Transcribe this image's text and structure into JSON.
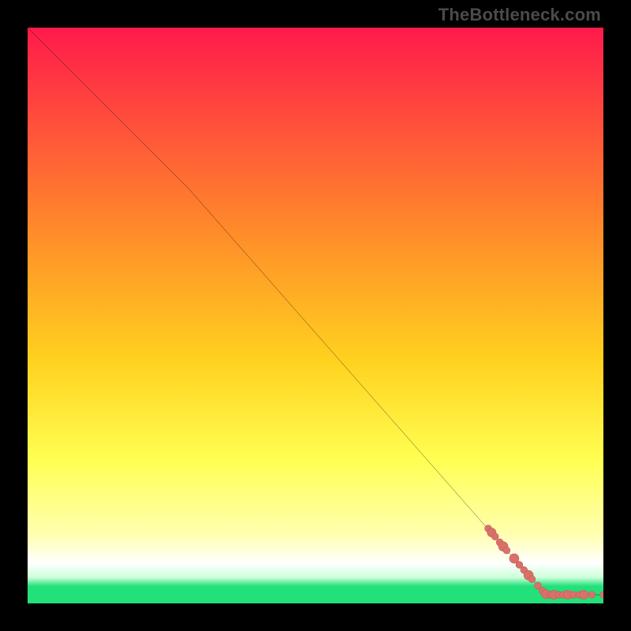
{
  "watermark": "TheBottleneck.com",
  "colors": {
    "gradient_top": "#ff1a4b",
    "gradient_mid1": "#ff8a2a",
    "gradient_mid2": "#ffd21f",
    "gradient_mid3": "#ffff52",
    "gradient_pale": "#ffffb0",
    "gradient_white": "#ffffff",
    "gradient_mint": "#ccffd9",
    "gradient_green": "#22e07a",
    "line": "#000000",
    "marker_fill": "#d9716b",
    "marker_stroke": "#c85a53",
    "frame": "#000000"
  },
  "chart_data": {
    "type": "line",
    "title": "",
    "xlabel": "",
    "ylabel": "",
    "xlim": [
      0,
      100
    ],
    "ylim": [
      0,
      100
    ],
    "series": [
      {
        "name": "curve",
        "kind": "line",
        "points": [
          {
            "x": 0,
            "y": 100
          },
          {
            "x": 28,
            "y": 72
          },
          {
            "x": 90,
            "y": 1.5
          },
          {
            "x": 100,
            "y": 1.5
          }
        ]
      },
      {
        "name": "markers",
        "kind": "scatter",
        "points": [
          {
            "x": 80.0,
            "y": 13.0,
            "r": 1.1
          },
          {
            "x": 80.6,
            "y": 12.3,
            "r": 1.4
          },
          {
            "x": 81.2,
            "y": 11.6,
            "r": 1.1
          },
          {
            "x": 82.0,
            "y": 10.6,
            "r": 1.1
          },
          {
            "x": 82.6,
            "y": 9.9,
            "r": 1.5
          },
          {
            "x": 83.2,
            "y": 9.2,
            "r": 1.1
          },
          {
            "x": 84.5,
            "y": 7.8,
            "r": 1.5
          },
          {
            "x": 85.4,
            "y": 6.7,
            "r": 1.1
          },
          {
            "x": 86.2,
            "y": 5.8,
            "r": 1.1
          },
          {
            "x": 87.0,
            "y": 4.9,
            "r": 1.5
          },
          {
            "x": 87.6,
            "y": 4.2,
            "r": 1.1
          },
          {
            "x": 88.6,
            "y": 3.1,
            "r": 1.1
          },
          {
            "x": 89.4,
            "y": 2.2,
            "r": 1.1
          },
          {
            "x": 90.0,
            "y": 1.6,
            "r": 1.4
          },
          {
            "x": 90.8,
            "y": 1.5,
            "r": 1.1
          },
          {
            "x": 91.4,
            "y": 1.5,
            "r": 1.4
          },
          {
            "x": 92.2,
            "y": 1.5,
            "r": 1.1
          },
          {
            "x": 93.0,
            "y": 1.5,
            "r": 1.1
          },
          {
            "x": 93.8,
            "y": 1.5,
            "r": 1.4
          },
          {
            "x": 94.8,
            "y": 1.5,
            "r": 1.1
          },
          {
            "x": 95.8,
            "y": 1.5,
            "r": 1.1
          },
          {
            "x": 96.6,
            "y": 1.5,
            "r": 1.4
          },
          {
            "x": 98.0,
            "y": 1.5,
            "r": 1.1
          },
          {
            "x": 100.0,
            "y": 1.5,
            "r": 1.1
          }
        ]
      }
    ]
  }
}
